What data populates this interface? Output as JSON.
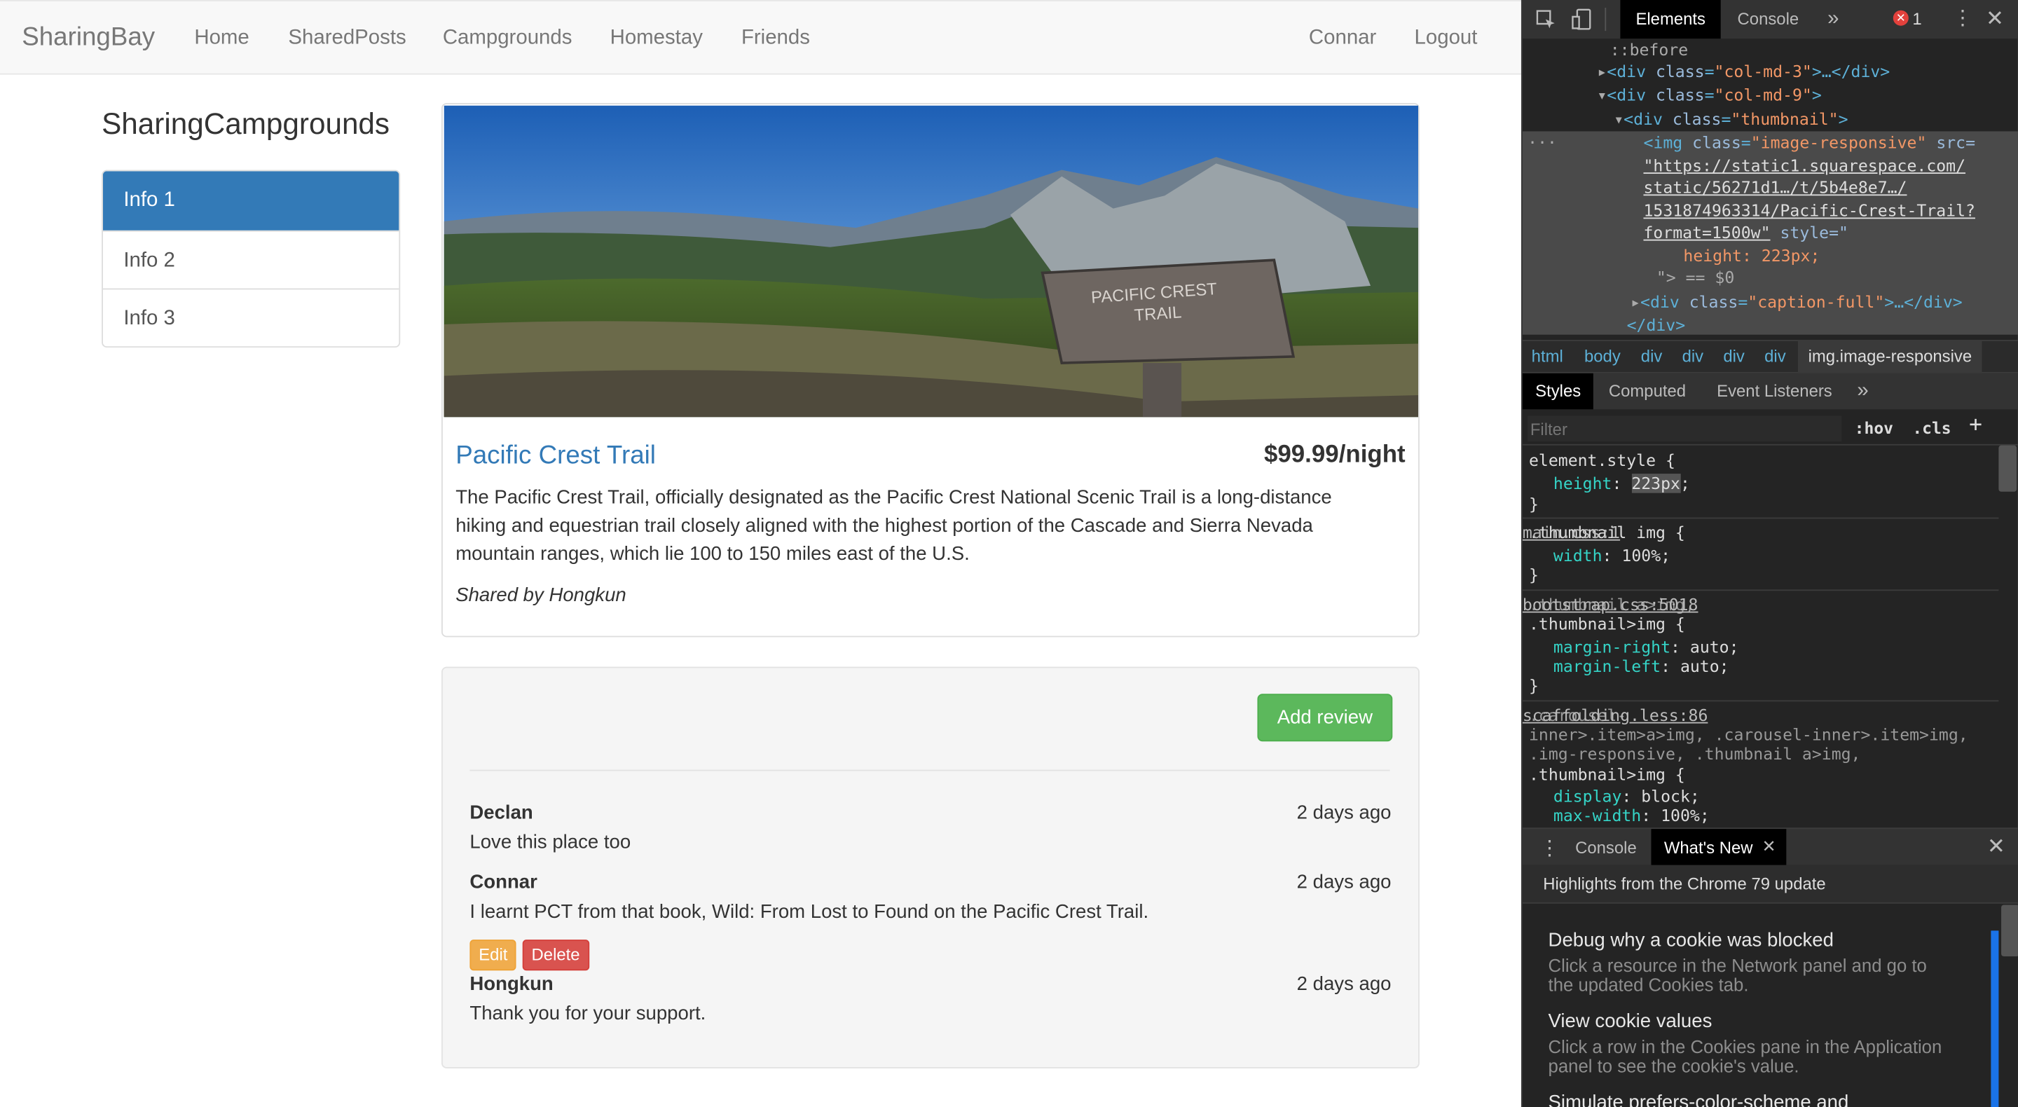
{
  "navbar": {
    "brand": "SharingBay",
    "links": [
      "Home",
      "SharedPosts",
      "Campgrounds",
      "Homestay",
      "Friends"
    ],
    "user": "Connar",
    "logout": "Logout"
  },
  "sidebar": {
    "title": "SharingCampgrounds",
    "items": [
      "Info 1",
      "Info 2",
      "Info 3"
    ]
  },
  "campground": {
    "name": "Pacific Crest Trail",
    "price": "$99.99/night",
    "description": "The Pacific Crest Trail, officially designated as the Pacific Crest National Scenic Trail is a long-distance hiking and equestrian trail closely aligned with the highest portion of the Cascade and Sierra Nevada mountain ranges, which lie 100 to 150 miles east of the U.S.",
    "shared_by": "Shared by Hongkun",
    "sign_line1": "PACIFIC CREST",
    "sign_line2": "TRAIL"
  },
  "reviews_panel": {
    "add_button": "Add review",
    "reviews": [
      {
        "author": "Declan",
        "time": "2 days ago",
        "text": "Love this place too"
      },
      {
        "author": "Connar",
        "time": "2 days ago",
        "text": "I learnt PCT from that book, Wild: From Lost to Found on the Pacific Crest Trail."
      },
      {
        "author": "Hongkun",
        "time": "2 days ago",
        "text": "Thank you for your support."
      }
    ],
    "edit_label": "Edit",
    "delete_label": "Delete"
  },
  "devtools": {
    "tabs": {
      "elements": "Elements",
      "console": "Console",
      "more": "»",
      "errors": "1"
    },
    "dom": {
      "before": "::before",
      "col3_class": "\"col-md-3\"",
      "col3_rest": ">…</div>",
      "col9_class": "\"col-md-9\"",
      "thumb_class": "\"thumbnail\"",
      "img_class": "\"image-responsive\"",
      "src1": "\"https://static1.squarespace.com/",
      "src2": "static/56271d1…/t/5b4e8e7…/",
      "src3": "1531874963314/Pacific-Crest-Trail?",
      "src4": "format=1500w\"",
      "style_label": "style=\"",
      "height_rule": "height: 223px;",
      "closing": "\"> == $0",
      "caption_class": "\"caption-full\"",
      "caption_rest": ">…</div>",
      "div_close": "</div>"
    },
    "breadcrumbs": [
      "html",
      "body",
      "div",
      "div",
      "div",
      "div",
      "img.image-responsive"
    ],
    "styles_tabs": [
      "Styles",
      "Computed",
      "Event Listeners",
      "»"
    ],
    "filter_placeholder": "Filter",
    "hov": ":hov",
    ".cls": ".cls",
    "rules": {
      "element_style": "element.style {",
      "r1_prop": "height",
      "r1_val": "223px",
      "r2_sel": ".thumbnail img {",
      "r2_src": "main.css:1",
      "r2_prop": "width",
      "r2_val": "100%;",
      "r3_sel1": ".thumbnail a>img,",
      "r3_sel2": ".thumbnail>img {",
      "r3_src": "bootstrap.css:5018",
      "r3_p1": "margin-right",
      "r3_v1": "auto;",
      "r3_p2": "margin-left",
      "r3_v2": "auto;",
      "r4_sel1": ".carousel-",
      "r4_sel2": "inner>.item>a>img, .carousel-inner>.item>img,",
      "r4_sel3": ".img-responsive, .thumbnail a>img,",
      "r4_sel4": ".thumbnail>img {",
      "r4_src": "scaffolding.less:86",
      "r4_p1": "display",
      "r4_v1": "block;",
      "r4_p2": "max-width",
      "r4_v2": "100%;",
      "close_brace": "}"
    },
    "drawer": {
      "console_tab": "Console",
      "whats_new_tab": "What's New",
      "highlights": "Highlights from the Chrome 79 update",
      "items": [
        {
          "title": "Debug why a cookie was blocked",
          "desc": "Click a resource in the Network panel and go to the updated Cookies tab."
        },
        {
          "title": "View cookie values",
          "desc": "Click a row in the Cookies pane in the Application panel to see the cookie's value."
        },
        {
          "title": "Simulate prefers-color-scheme and",
          "desc": ""
        }
      ]
    }
  }
}
